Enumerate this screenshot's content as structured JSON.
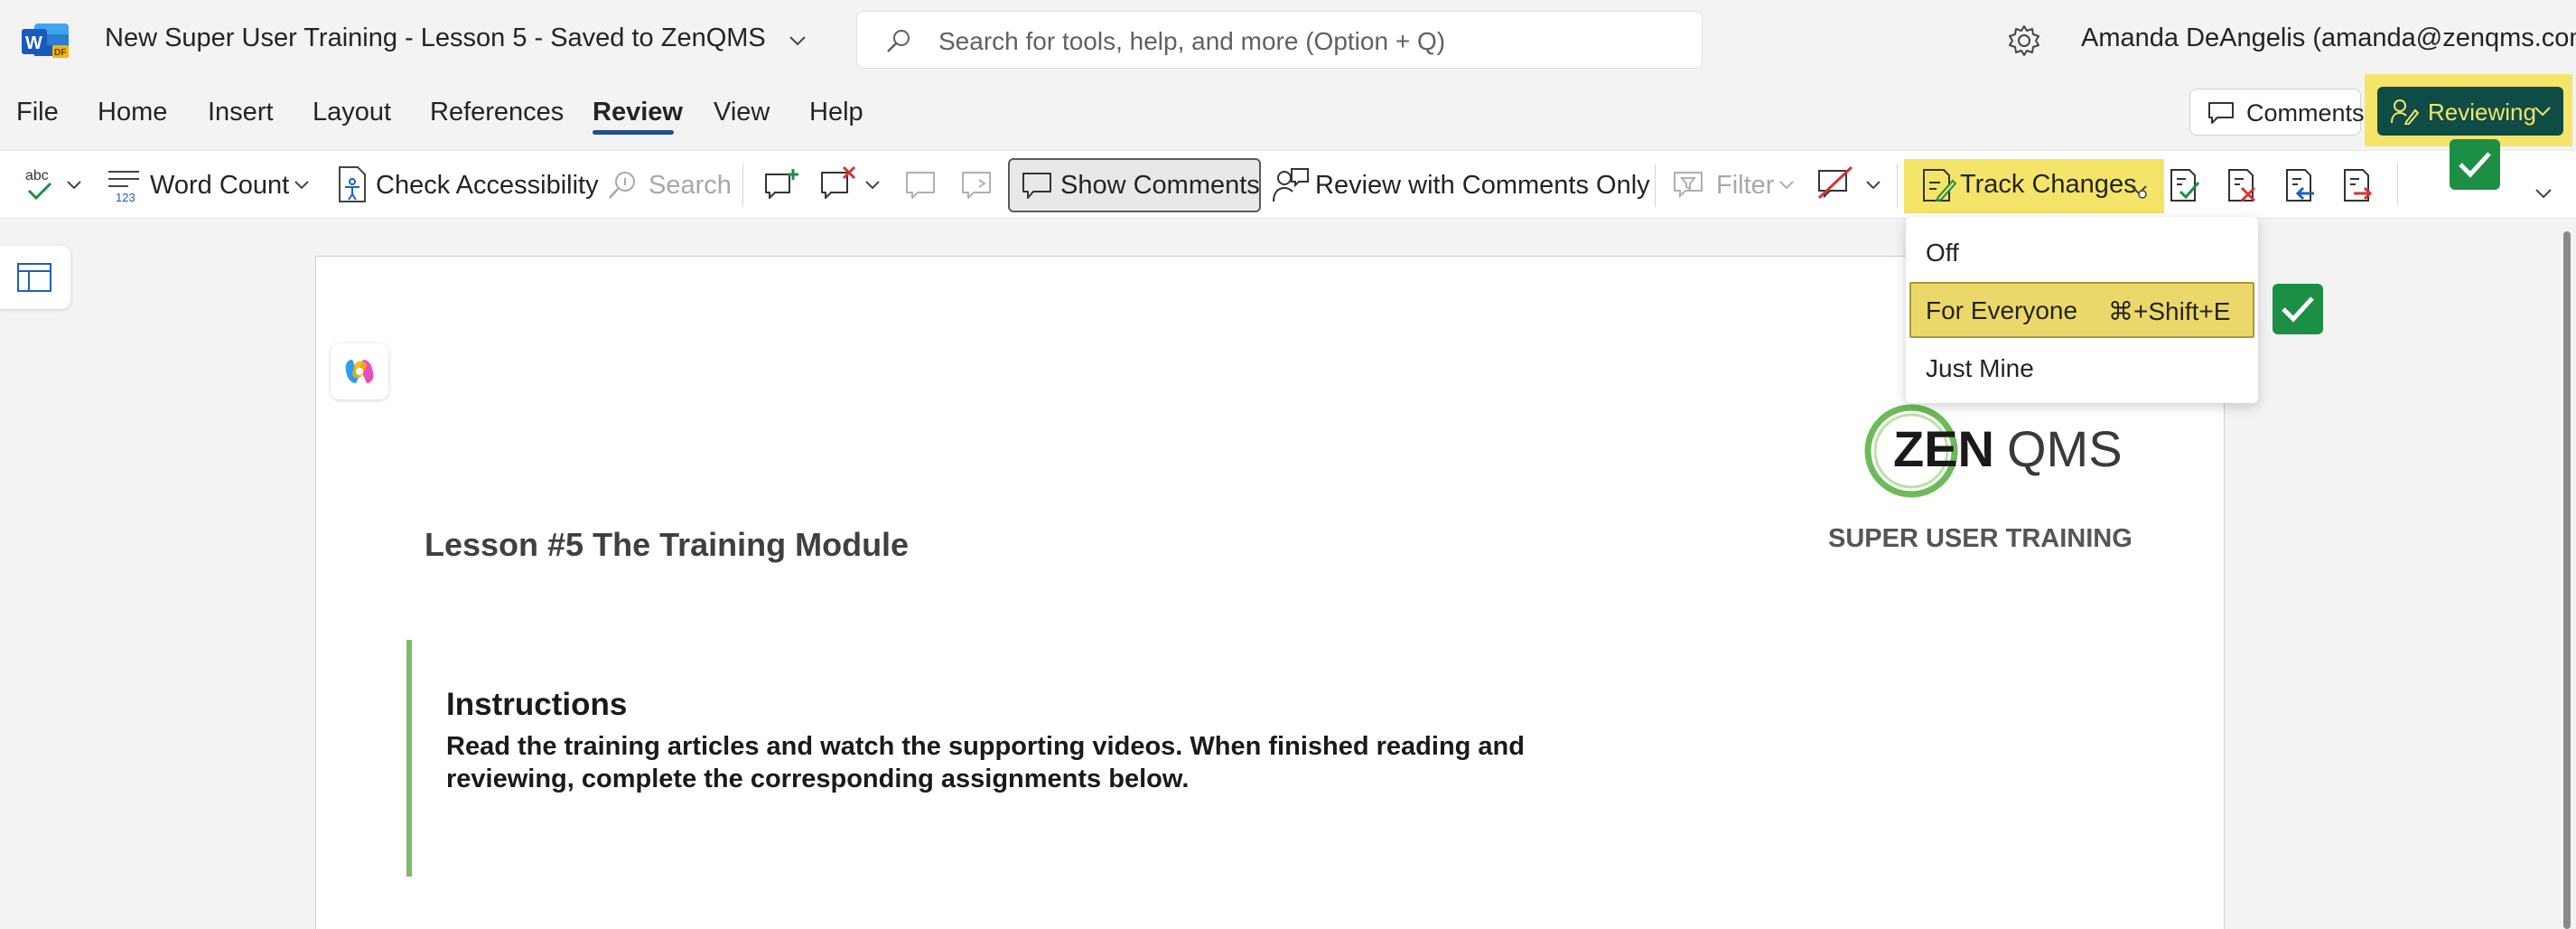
{
  "titlebar": {
    "doc_title": "New Super User Training - Lesson 5  -  Saved to ZenQMS",
    "search_placeholder": "Search for tools, help, and more (Option + Q)",
    "user": "Amanda DeAngelis (amanda@zenqms.com)"
  },
  "tabs": [
    "File",
    "Home",
    "Insert",
    "Layout",
    "References",
    "Review",
    "View",
    "Help"
  ],
  "active_tab": "Review",
  "header_buttons": {
    "comments": "Comments",
    "reviewing": "Reviewing"
  },
  "ribbon": {
    "word_count": "Word Count",
    "check_accessibility": "Check Accessibility",
    "search": "Search",
    "show_comments": "Show Comments",
    "review_with_comments_only": "Review with Comments Only",
    "filter": "Filter",
    "track_changes": "Track Changes"
  },
  "track_changes_menu": {
    "items": [
      {
        "label": "Off",
        "shortcut": ""
      },
      {
        "label": "For Everyone",
        "shortcut": "⌘+Shift+E"
      },
      {
        "label": "Just Mine",
        "shortcut": ""
      }
    ],
    "selected": "For Everyone"
  },
  "document": {
    "lesson_title": "Lesson #5 The Training Module",
    "logo_text_zen": "ZEN",
    "logo_text_qms": "QMS",
    "logo_subtitle": "SUPER USER TRAINING",
    "instructions_heading": "Instructions",
    "instructions_body": "Read the training articles and watch the supporting videos. When finished reading and reviewing, complete the corresponding assignments below."
  },
  "colors": {
    "accent_yellow": "#f4e469",
    "reviewing_bg": "#0f4c45",
    "check_green": "#1d8f45",
    "instructions_bar": "#7dbb6a",
    "tab_underline": "#1f4e8c"
  }
}
